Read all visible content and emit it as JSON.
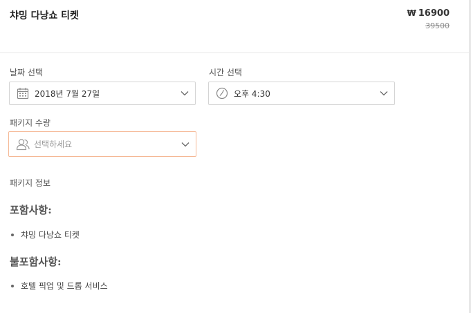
{
  "product": {
    "title": "챠밍 다낭쇼 티켓",
    "currency_symbol": "₩",
    "price": "16900",
    "original_price": "39500"
  },
  "date_select": {
    "label": "날짜 선택",
    "value": "2018년 7월 27일",
    "icon": "calendar-icon"
  },
  "time_select": {
    "label": "시간 선택",
    "value": "오후 4:30",
    "icon": "clock-icon"
  },
  "package_qty": {
    "label": "패키지 수량",
    "placeholder": "선택하세요",
    "icon": "people-icon"
  },
  "package_info": {
    "label": "패키지 정보",
    "included_heading": "포함사항:",
    "included_items": [
      "챠밍 다낭쇼 티켓"
    ],
    "excluded_heading": "불포함사항:",
    "excluded_items": [
      "호텔 픽업 및 드롭 서비스"
    ]
  },
  "colors": {
    "active_border": "#f5b895",
    "border": "#d4d4d4",
    "divider": "#e6e6e6"
  }
}
